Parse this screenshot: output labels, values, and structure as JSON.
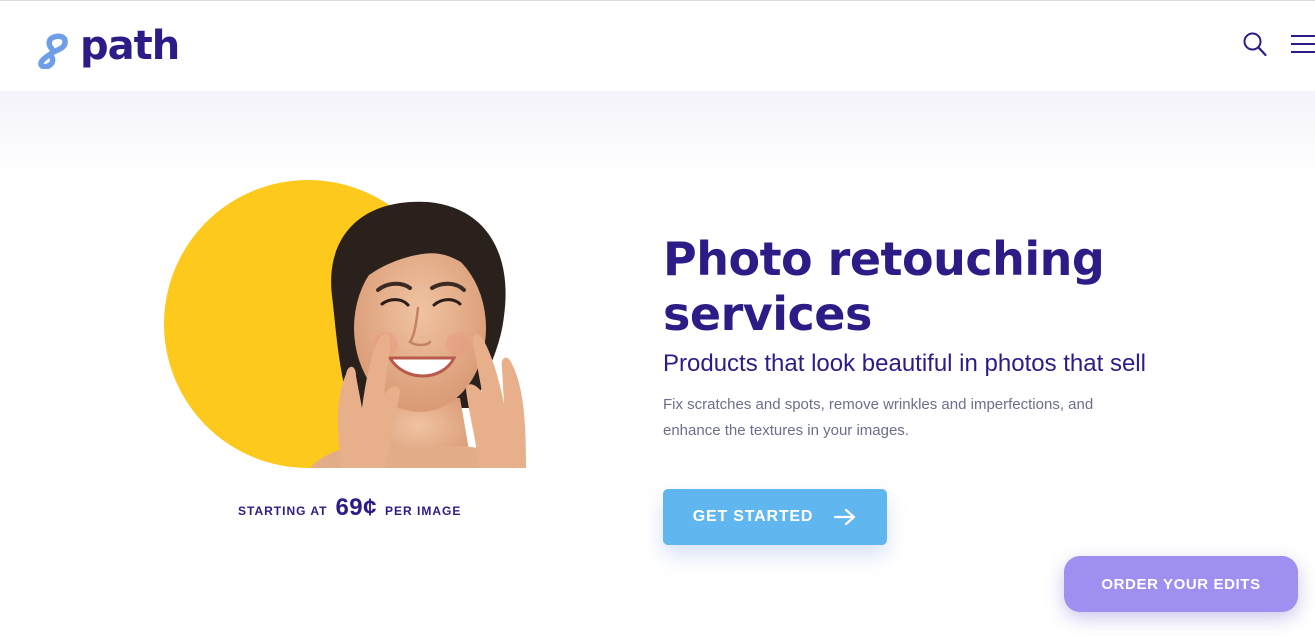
{
  "header": {
    "logo_text": "path",
    "icons": {
      "search": "search-icon",
      "menu": "hamburger-menu-icon"
    }
  },
  "hero": {
    "title": "Photo retouching services",
    "subtitle": "Products that look beautiful in photos that sell",
    "description": "Fix scratches and spots, remove wrinkles and imperfections, and enhance the textures in your images.",
    "cta_label": "GET STARTED",
    "cta_icon": "arrow-right-icon",
    "image": "smiling-woman-portrait-with-yellow-circle"
  },
  "pricing": {
    "prefix": "STARTING AT",
    "amount": "69¢",
    "suffix": "PER IMAGE"
  },
  "floating": {
    "order_label": "ORDER YOUR EDITS"
  },
  "colors": {
    "brand_navy": "#2b1c86",
    "cta_blue": "#60b6ee",
    "order_purple": "#9f8ff0",
    "accent_yellow": "#fcc91c",
    "logo_blue": "#6f9ee8"
  }
}
